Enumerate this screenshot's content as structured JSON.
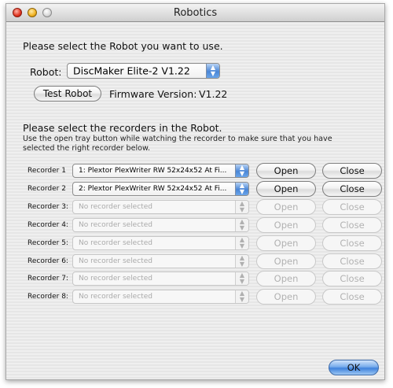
{
  "window": {
    "title": "Robotics"
  },
  "robot_section": {
    "heading": "Please select the Robot you want to use.",
    "robot_label": "Robot:",
    "robot_value": "DiscMaker Elite-2 V1.22",
    "test_button": "Test Robot",
    "firmware_label": "Firmware Version:",
    "firmware_value": "V1.22"
  },
  "recorders_section": {
    "heading": "Please select the recorders in the Robot.",
    "hint_line1": "Use the open tray button while watching the recorder to make sure that you have",
    "hint_line2": "selected the right recorder below.",
    "open_label": "Open",
    "close_label": "Close",
    "recorders": [
      {
        "label": "Recorder 1",
        "value": "1: Plextor PlexWriter RW 52x24x52 At Fi...",
        "enabled": true
      },
      {
        "label": "Recorder 2",
        "value": "2: Plextor PlexWriter RW 52x24x52 At Fi...",
        "enabled": true
      },
      {
        "label": "Recorder 3:",
        "value": "No recorder selected",
        "enabled": false
      },
      {
        "label": "Recorder 4:",
        "value": "No recorder selected",
        "enabled": false
      },
      {
        "label": "Recorder 5:",
        "value": "No recorder selected",
        "enabled": false
      },
      {
        "label": "Recorder 6:",
        "value": "No recorder selected",
        "enabled": false
      },
      {
        "label": "Recorder 7:",
        "value": "No recorder selected",
        "enabled": false
      },
      {
        "label": "Recorder 8:",
        "value": "No recorder selected",
        "enabled": false
      }
    ]
  },
  "ok_button": "OK",
  "colors": {
    "accent": "#4a86d6",
    "disabled_text": "#aaaaaa"
  }
}
